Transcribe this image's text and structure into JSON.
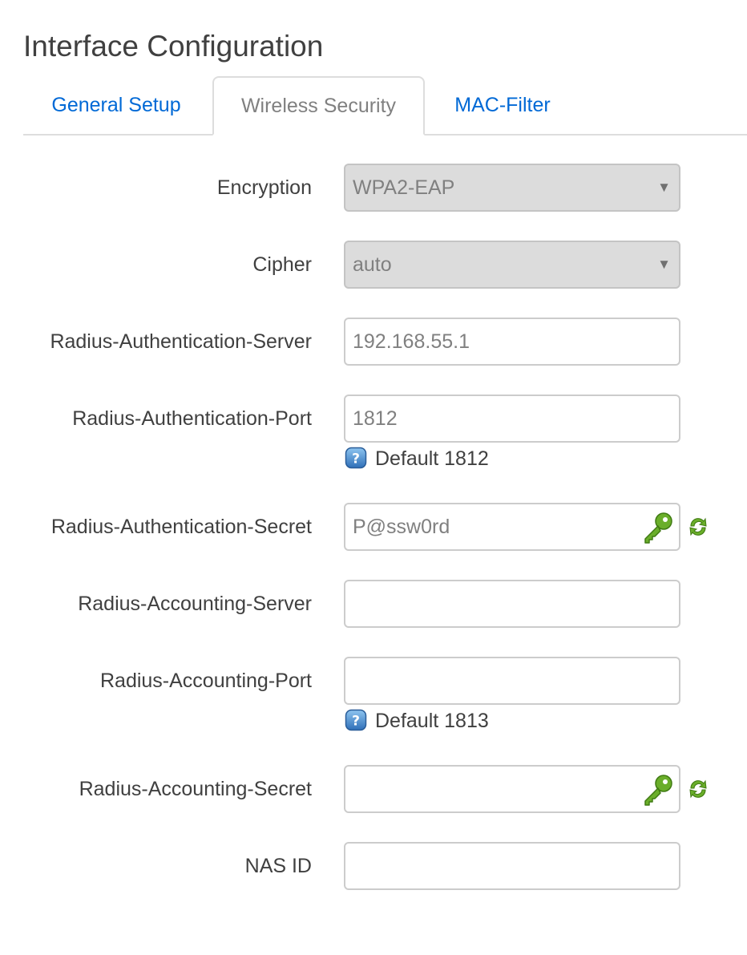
{
  "page": {
    "title": "Interface Configuration"
  },
  "tabs": [
    {
      "label": "General Setup",
      "active": false
    },
    {
      "label": "Wireless Security",
      "active": true
    },
    {
      "label": "MAC-Filter",
      "active": false
    }
  ],
  "form": {
    "encryption": {
      "label": "Encryption",
      "value": "WPA2-EAP"
    },
    "cipher": {
      "label": "Cipher",
      "value": "auto"
    },
    "auth_server": {
      "label": "Radius-Authentication-Server",
      "value": "192.168.55.1"
    },
    "auth_port": {
      "label": "Radius-Authentication-Port",
      "value": "1812",
      "hint": "Default 1812"
    },
    "auth_secret": {
      "label": "Radius-Authentication-Secret",
      "value": "P@ssw0rd"
    },
    "acct_server": {
      "label": "Radius-Accounting-Server",
      "value": ""
    },
    "acct_port": {
      "label": "Radius-Accounting-Port",
      "value": "",
      "hint": "Default 1813"
    },
    "acct_secret": {
      "label": "Radius-Accounting-Secret",
      "value": ""
    },
    "nas_id": {
      "label": "NAS ID",
      "value": ""
    }
  },
  "icons": {
    "key": "key-icon",
    "refresh": "refresh-icon",
    "help": "help-icon",
    "dropdown": "chevron-down-icon"
  },
  "colors": {
    "link": "#0069d6",
    "key_green": "#5a9a1e",
    "help_blue": "#3a7fc4"
  }
}
